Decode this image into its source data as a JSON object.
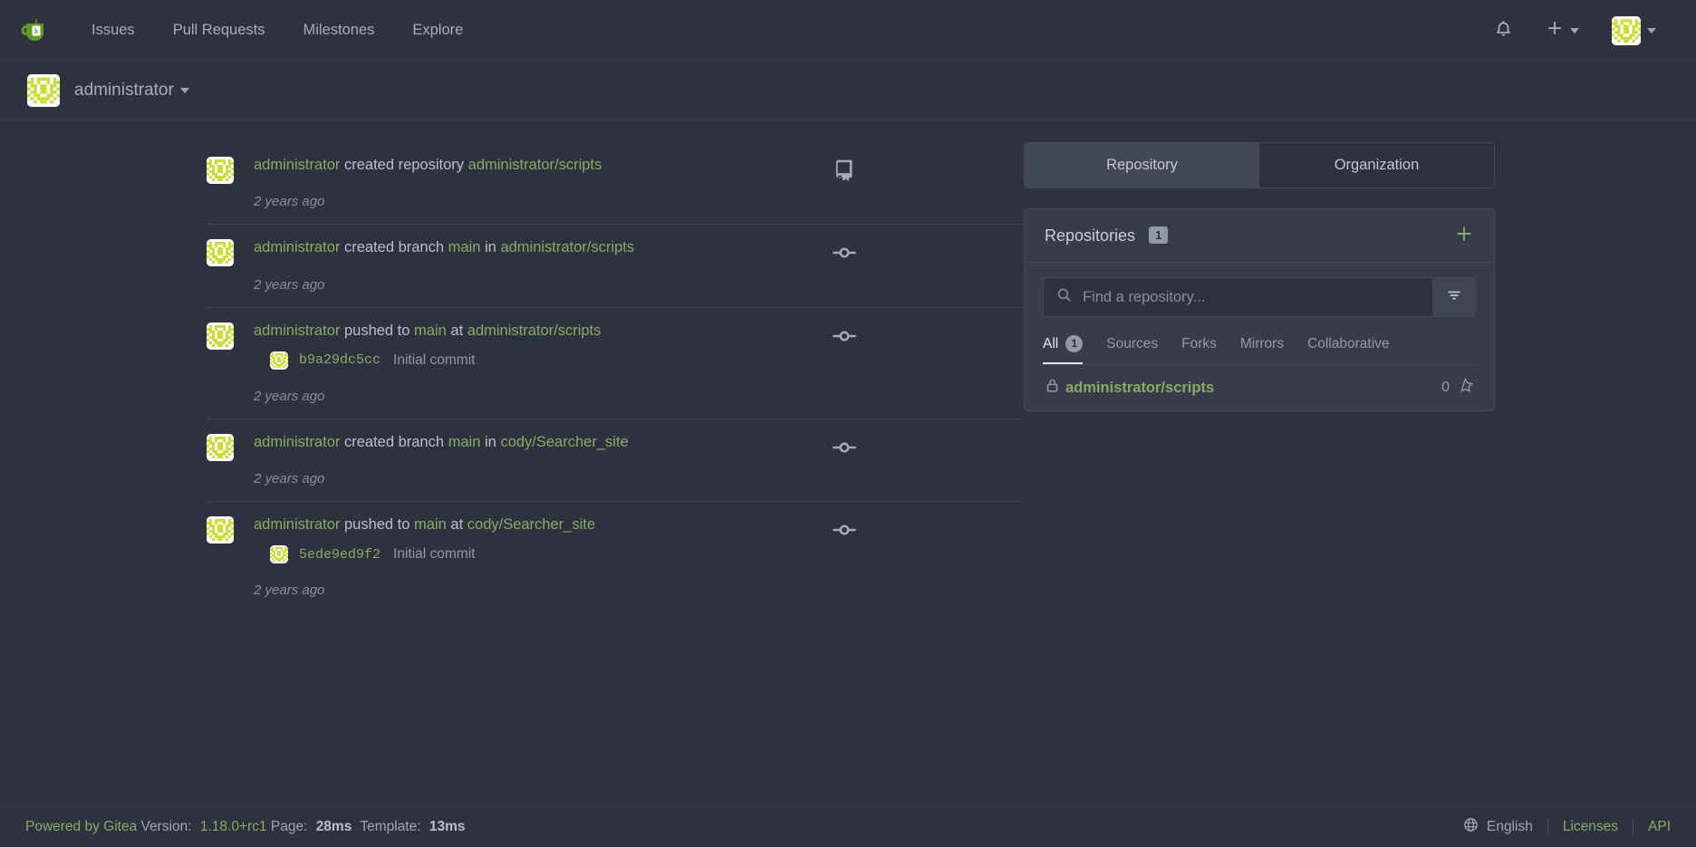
{
  "navbar": {
    "logo_icon": "gitea-logo-icon",
    "links": [
      {
        "label": "Issues"
      },
      {
        "label": "Pull Requests"
      },
      {
        "label": "Milestones"
      },
      {
        "label": "Explore"
      }
    ],
    "bell_icon": "bell-icon",
    "plus_icon": "plus-icon",
    "avatar_icon": "user-avatar-identicon"
  },
  "context": {
    "username": "administrator",
    "avatar_icon": "user-avatar-identicon"
  },
  "feed": [
    {
      "actor": "administrator",
      "action": "created repository",
      "branch": null,
      "preposition": null,
      "repo": "administrator/scripts",
      "time": "2 years ago",
      "op_icon": "repo-icon",
      "commit": null
    },
    {
      "actor": "administrator",
      "action": "created branch",
      "branch": "main",
      "preposition": "in",
      "repo": "administrator/scripts",
      "time": "2 years ago",
      "op_icon": "git-commit-icon",
      "commit": null
    },
    {
      "actor": "administrator",
      "action": "pushed to",
      "branch": "main",
      "preposition": "at",
      "repo": "administrator/scripts",
      "time": "2 years ago",
      "op_icon": "git-commit-icon",
      "commit": {
        "sha": "b9a29dc5cc",
        "message": "Initial commit"
      }
    },
    {
      "actor": "administrator",
      "action": "created branch",
      "branch": "main",
      "preposition": "in",
      "repo": "cody/Searcher_site",
      "time": "2 years ago",
      "op_icon": "git-commit-icon",
      "commit": null
    },
    {
      "actor": "administrator",
      "action": "pushed to",
      "branch": "main",
      "preposition": "at",
      "repo": "cody/Searcher_site",
      "time": "2 years ago",
      "op_icon": "git-commit-icon",
      "commit": {
        "sha": "5ede9ed9f2",
        "message": "Initial commit"
      }
    }
  ],
  "sidebar": {
    "segments": [
      {
        "label": "Repository",
        "active": true
      },
      {
        "label": "Organization",
        "active": false
      }
    ],
    "panel_title": "Repositories",
    "panel_count": "1",
    "add_icon": "plus-icon",
    "search": {
      "placeholder": "Find a repository...",
      "value": "",
      "search_icon": "search-icon",
      "filter_icon": "filter-icon"
    },
    "filter_tabs": [
      {
        "label": "All",
        "badge": "1",
        "active": true
      },
      {
        "label": "Sources",
        "badge": null,
        "active": false
      },
      {
        "label": "Forks",
        "badge": null,
        "active": false
      },
      {
        "label": "Mirrors",
        "badge": null,
        "active": false
      },
      {
        "label": "Collaborative",
        "badge": null,
        "active": false
      }
    ],
    "repos": [
      {
        "name": "administrator/scripts",
        "stars": "0",
        "private": true,
        "lock_icon": "lock-icon",
        "star_icon": "star-icon"
      }
    ]
  },
  "footer": {
    "powered_by": "Powered by Gitea",
    "version_label": "Version:",
    "version": "1.18.0+rc1",
    "page_label": "Page:",
    "page_time": "28ms",
    "template_label": "Template:",
    "template_time": "13ms",
    "language": "English",
    "globe_icon": "globe-icon",
    "licenses": "Licenses",
    "api": "API"
  },
  "colors": {
    "page_bg": "#2e323e",
    "panel_bg": "#383c4a",
    "accent_green": "#87ab63",
    "border": "#434857",
    "text": "#9ea4b0",
    "avatar_yellow": "#cddc39"
  }
}
